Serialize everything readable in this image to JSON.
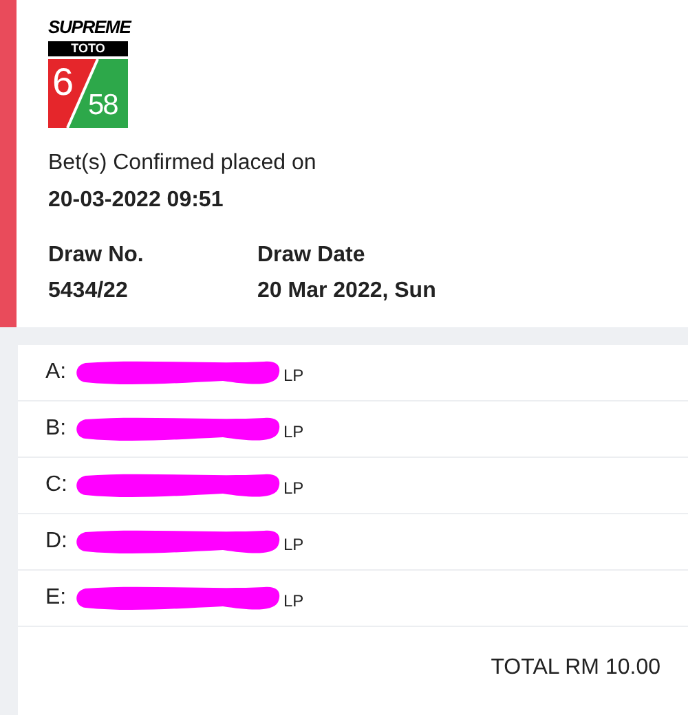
{
  "logo": {
    "brand": "SUPREME",
    "game": "TOTO",
    "left_digit": "6",
    "right_digits": "58"
  },
  "confirmation": {
    "message": "Bet(s) Confirmed placed on",
    "datetime": "20-03-2022 09:51"
  },
  "draw_info": [
    {
      "label": "Draw No.",
      "value": "5434/22"
    },
    {
      "label": "Draw Date",
      "value": "20 Mar 2022, Sun"
    }
  ],
  "bets": [
    {
      "label": "A:",
      "redacted": true,
      "suffix": "LP"
    },
    {
      "label": "B:",
      "redacted": true,
      "suffix": "LP"
    },
    {
      "label": "C:",
      "redacted": true,
      "suffix": "LP"
    },
    {
      "label": "D:",
      "redacted": true,
      "suffix": "LP"
    },
    {
      "label": "E:",
      "redacted": true,
      "suffix": "LP"
    }
  ],
  "total": "TOTAL RM 10.00"
}
